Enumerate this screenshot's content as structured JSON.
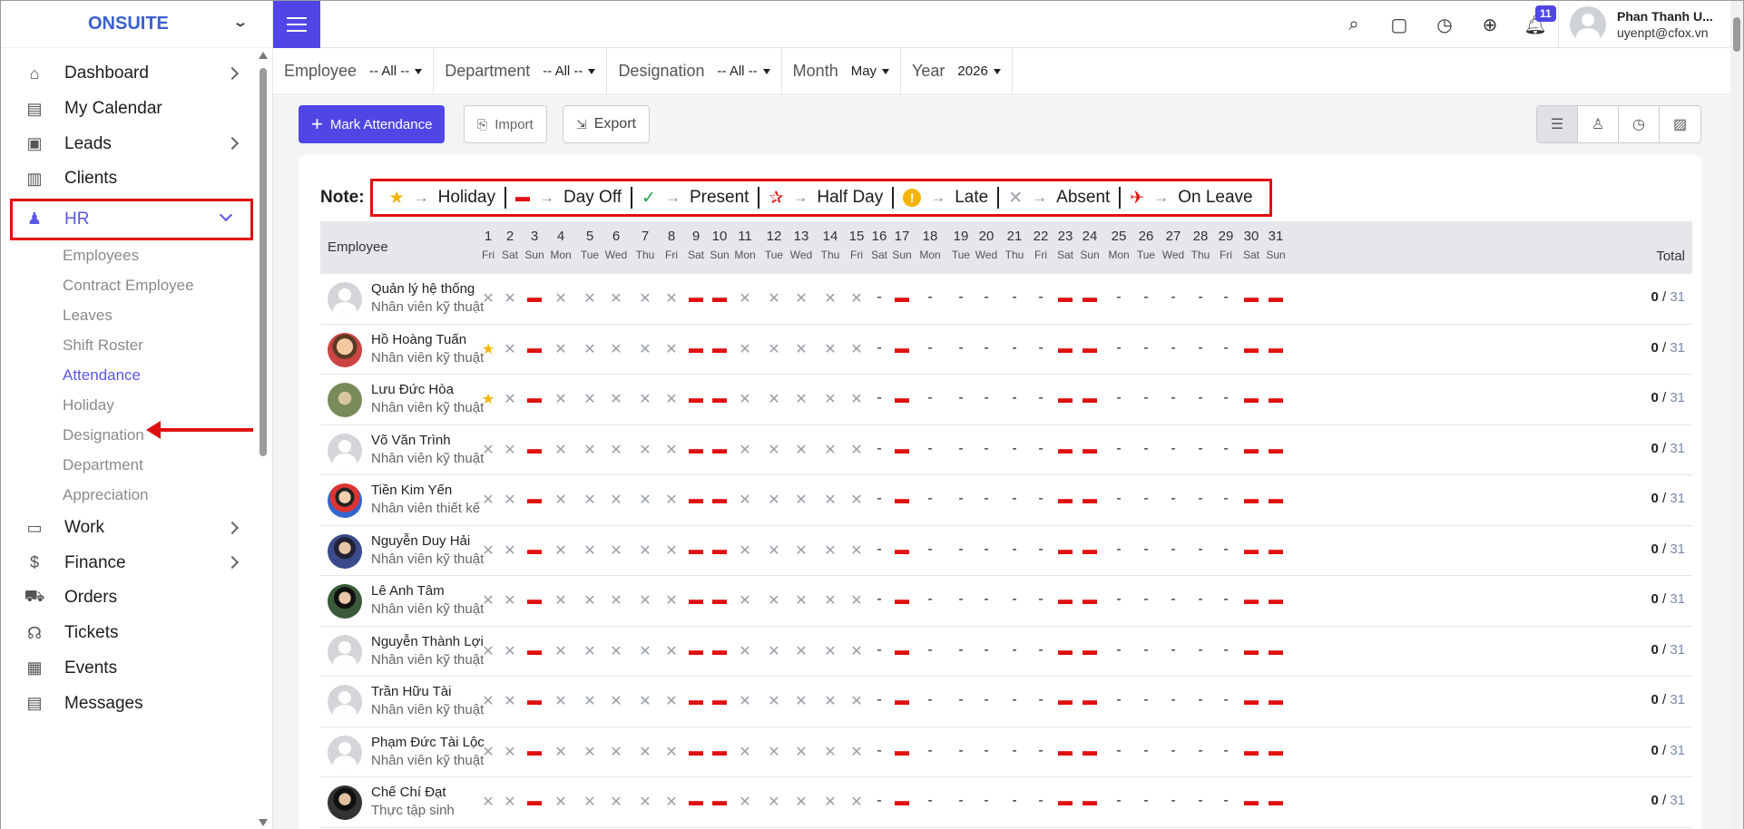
{
  "brand": "ONSUITE",
  "sidebar": {
    "items": [
      {
        "label": "Dashboard",
        "icon": "house-icon",
        "glyph": "⌂",
        "arrow": true
      },
      {
        "label": "My Calendar",
        "icon": "calendar-icon",
        "glyph": "▤",
        "arrow": false
      },
      {
        "label": "Leads",
        "icon": "id-card-icon",
        "glyph": "▣",
        "arrow": true
      },
      {
        "label": "Clients",
        "icon": "building-icon",
        "glyph": "▥",
        "arrow": false
      },
      {
        "label": "HR",
        "icon": "users-icon",
        "glyph": "♟",
        "arrow": true,
        "expanded": true
      }
    ],
    "hr_sub": [
      "Employees",
      "Contract Employee",
      "Leaves",
      "Shift Roster",
      "Attendance",
      "Holiday",
      "Designation",
      "Department",
      "Appreciation"
    ],
    "active_sub": "Attendance",
    "items_after": [
      {
        "label": "Work",
        "icon": "briefcase-icon",
        "glyph": "▭",
        "arrow": true
      },
      {
        "label": "Finance",
        "icon": "dollar-icon",
        "glyph": "$",
        "arrow": true
      },
      {
        "label": "Orders",
        "icon": "cart-icon",
        "glyph": "⛟",
        "arrow": false
      },
      {
        "label": "Tickets",
        "icon": "headset-icon",
        "glyph": "☊",
        "arrow": false
      },
      {
        "label": "Events",
        "icon": "event-calendar-icon",
        "glyph": "▦",
        "arrow": false
      },
      {
        "label": "Messages",
        "icon": "message-icon",
        "glyph": "▤",
        "arrow": false
      }
    ]
  },
  "topbar": {
    "notification_count": "11",
    "user_name": "Phan Thanh U...",
    "user_email": "uyenpt@cfox.vn"
  },
  "filters": [
    {
      "label": "Employee",
      "value": "-- All --"
    },
    {
      "label": "Department",
      "value": "-- All --"
    },
    {
      "label": "Designation",
      "value": "-- All --"
    },
    {
      "label": "Month",
      "value": "May"
    },
    {
      "label": "Year",
      "value": "2026"
    }
  ],
  "actions": {
    "mark": "Mark Attendance",
    "import": "Import",
    "export": "Export"
  },
  "note": {
    "label": "Note:",
    "legend": [
      {
        "glyph": "★",
        "color": "#f5b400",
        "label": "Holiday",
        "icon": "star-icon"
      },
      {
        "glyph": "▬",
        "color": "#e01010",
        "label": "Day Off",
        "icon": "calendar-off-icon"
      },
      {
        "glyph": "✓",
        "color": "#22a04a",
        "label": "Present",
        "icon": "check-icon"
      },
      {
        "glyph": "✰",
        "color": "#e01010",
        "label": "Half Day",
        "icon": "half-star-icon"
      },
      {
        "glyph": "!",
        "color": "#f5b400",
        "label": "Late",
        "icon": "exclamation-circle-icon"
      },
      {
        "glyph": "✕",
        "color": "#9aa0a8",
        "label": "Absent",
        "icon": "x-icon"
      },
      {
        "glyph": "✈",
        "color": "#e01010",
        "label": "On Leave",
        "icon": "plane-icon"
      }
    ]
  },
  "table": {
    "employee_header": "Employee",
    "total_header": "Total",
    "days": [
      "1",
      "2",
      "3",
      "4",
      "5",
      "6",
      "7",
      "8",
      "9",
      "10",
      "11",
      "12",
      "13",
      "14",
      "15",
      "16",
      "17",
      "18",
      "19",
      "20",
      "21",
      "22",
      "23",
      "24",
      "25",
      "26",
      "27",
      "28",
      "29",
      "30",
      "31"
    ],
    "weekdays": [
      "Fri",
      "Sat",
      "Sun",
      "Mon",
      "Tue",
      "Wed",
      "Thu",
      "Fri",
      "Sat",
      "Sun",
      "Mon",
      "Tue",
      "Wed",
      "Thu",
      "Fri",
      "Sat",
      "Sun",
      "Mon",
      "Tue",
      "Wed",
      "Thu",
      "Fri",
      "Sat",
      "Sun",
      "Mon",
      "Tue",
      "Wed",
      "Thu",
      "Fri",
      "Sat",
      "Sun"
    ],
    "rows": [
      {
        "name": "Quản lý hệ thống",
        "designation": "Nhân viên kỹ thuật",
        "avatar": "def",
        "first": "x",
        "present": "0",
        "total": "31"
      },
      {
        "name": "Hồ Hoàng Tuấn",
        "designation": "Nhân viên kỹ thuật",
        "avatar": "p1",
        "first": "star",
        "present": "0",
        "total": "31"
      },
      {
        "name": "Lưu Đức Hòa",
        "designation": "Nhân viên kỹ thuật",
        "avatar": "p2",
        "first": "star",
        "present": "0",
        "total": "31"
      },
      {
        "name": "Võ Văn Trình",
        "designation": "Nhân viên kỹ thuật",
        "avatar": "def",
        "first": "x",
        "present": "0",
        "total": "31"
      },
      {
        "name": "Tiền Kim Yến",
        "designation": "Nhân viên thiết kế",
        "avatar": "p3",
        "first": "x",
        "present": "0",
        "total": "31"
      },
      {
        "name": "Nguyễn Duy Hải",
        "designation": "Nhân viên kỹ thuật",
        "avatar": "p4",
        "first": "x",
        "present": "0",
        "total": "31"
      },
      {
        "name": "Lê Anh Tâm",
        "designation": "Nhân viên kỹ thuật",
        "avatar": "p5",
        "first": "x",
        "present": "0",
        "total": "31"
      },
      {
        "name": "Nguyễn Thành Lợi",
        "designation": "Nhân viên kỹ thuật",
        "avatar": "def",
        "first": "x",
        "present": "0",
        "total": "31"
      },
      {
        "name": "Trần Hữu Tài",
        "designation": "Nhân viên kỹ thuật",
        "avatar": "def",
        "first": "x",
        "present": "0",
        "total": "31"
      },
      {
        "name": "Phạm Đức Tài Lộc",
        "designation": "Nhân viên kỹ thuật",
        "avatar": "def",
        "first": "x",
        "present": "0",
        "total": "31"
      },
      {
        "name": "Chế Chí Đạt",
        "designation": "Thực tập sinh",
        "avatar": "p6",
        "first": "x",
        "present": "0",
        "total": "31"
      }
    ],
    "day_pattern": [
      "x",
      "cal",
      "x",
      "x",
      "x",
      "x",
      "x",
      "cal",
      "cal",
      "x",
      "x",
      "x",
      "x",
      "x",
      "dash",
      "cal",
      "dash",
      "dash",
      "dash",
      "dash",
      "dash",
      "cal",
      "cal",
      "dash",
      "dash",
      "dash",
      "dash",
      "dash",
      "cal",
      "cal"
    ]
  }
}
